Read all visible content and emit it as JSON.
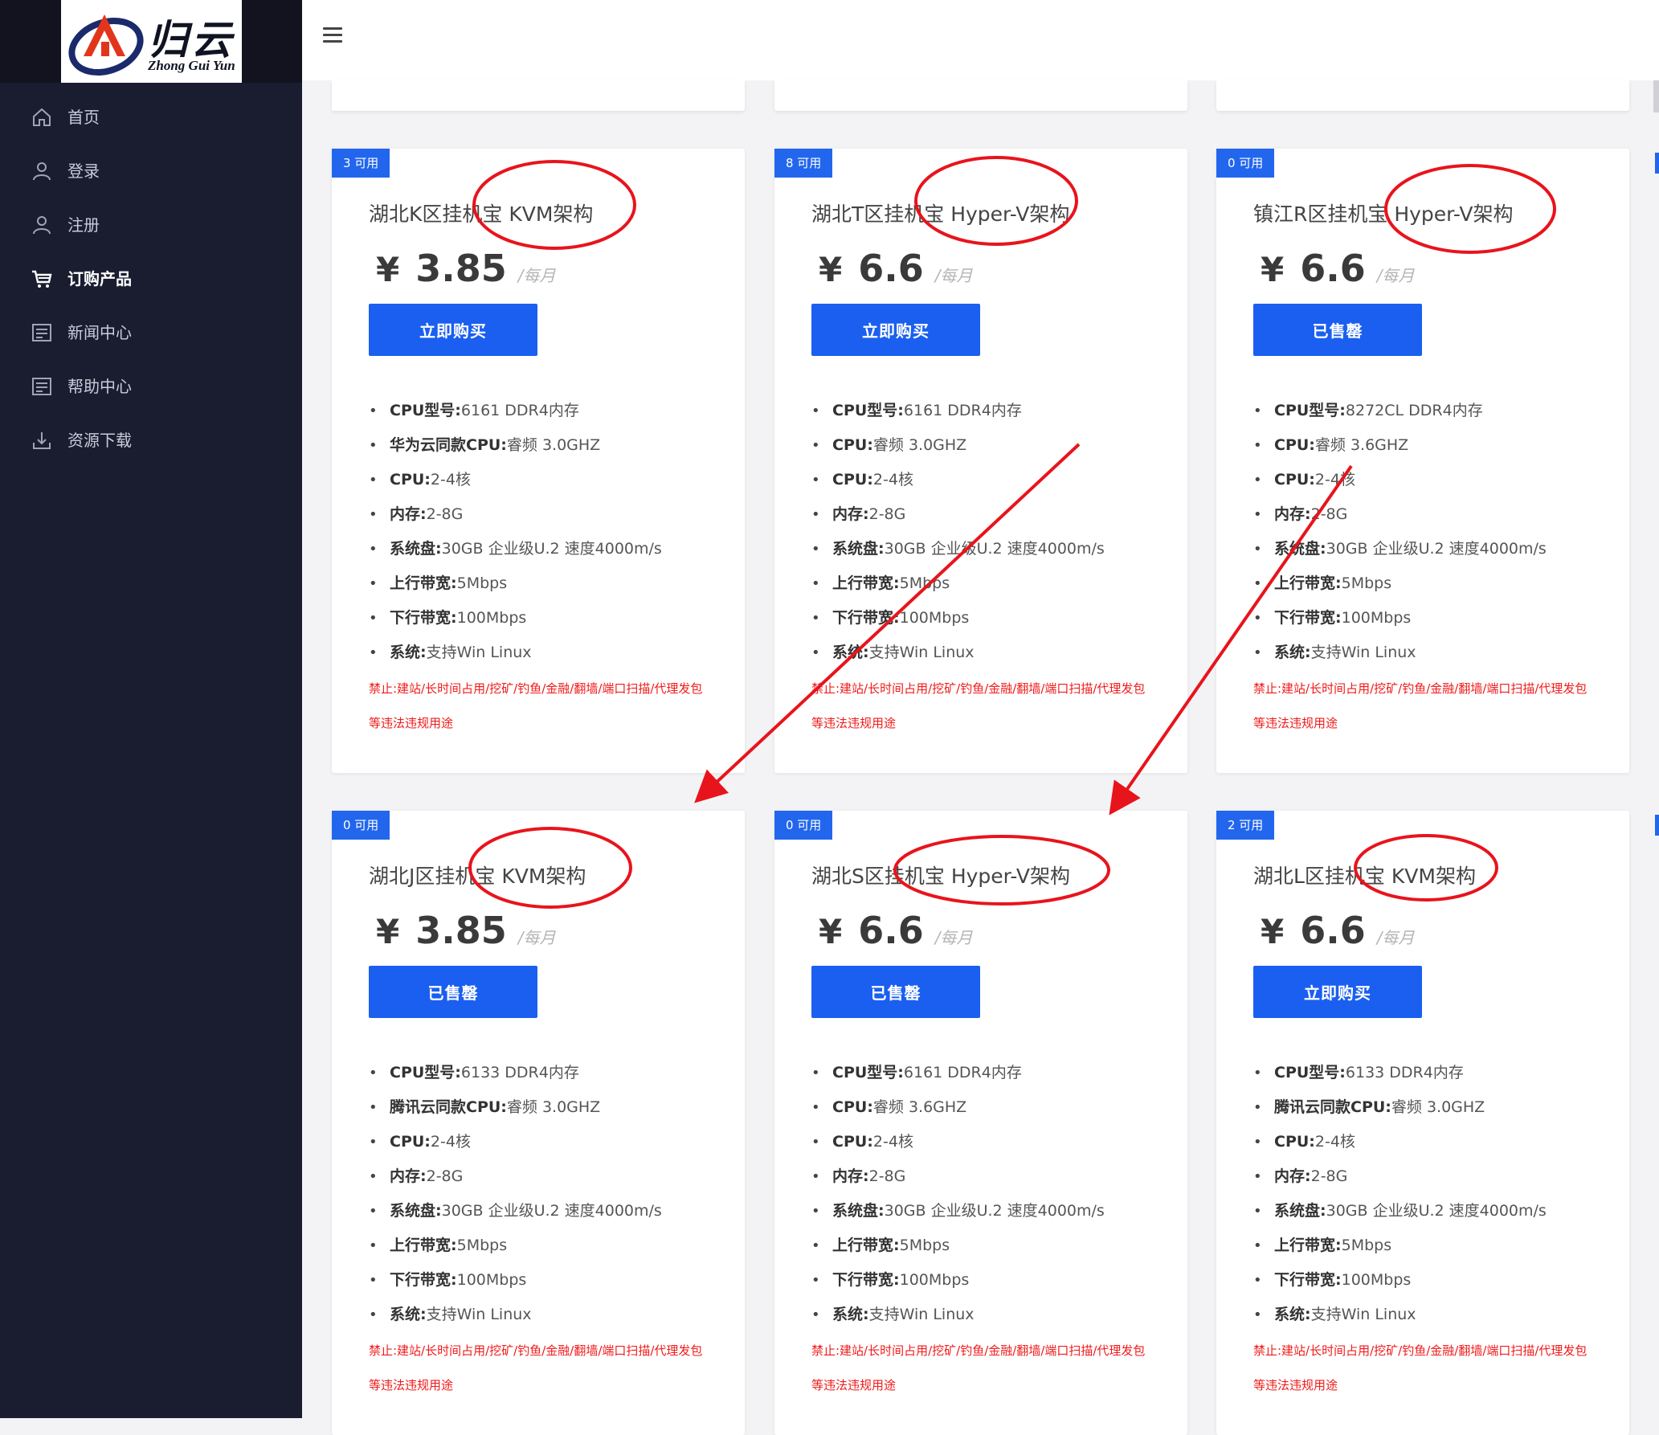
{
  "logo": {
    "text": "归云",
    "sub": "Zhong Gui Yun"
  },
  "nav": [
    {
      "label": "首页",
      "icon": "home-icon",
      "active": false
    },
    {
      "label": "登录",
      "icon": "user-icon",
      "active": false
    },
    {
      "label": "注册",
      "icon": "user-icon",
      "active": false
    },
    {
      "label": "订购产品",
      "icon": "cart-icon",
      "active": true
    },
    {
      "label": "新闻中心",
      "icon": "document-icon",
      "active": false
    },
    {
      "label": "帮助中心",
      "icon": "document-icon",
      "active": false
    },
    {
      "label": "资源下载",
      "icon": "download-icon",
      "active": false
    }
  ],
  "accent": "#1a5ff0",
  "annotation_color": "#e8141c",
  "warn_color": "#f01a1a",
  "products": [
    {
      "badge": "3 可用",
      "title": "湖北K区挂机宝 KVM架构",
      "currency": "¥",
      "price": "3.85",
      "period": "/每月",
      "button": "立即购买",
      "specs": [
        {
          "k": "CPU型号:",
          "v": "6161 DDR4内存"
        },
        {
          "k": "华为云同款CPU:",
          "v": "睿频 3.0GHZ"
        },
        {
          "k": "CPU:",
          "v": "2-4核"
        },
        {
          "k": "内存:",
          "v": "2-8G"
        },
        {
          "k": "系统盘:",
          "v": "30GB 企业级U.2 速度4000m/s"
        },
        {
          "k": "上行带宽:",
          "v": "5Mbps"
        },
        {
          "k": "下行带宽:",
          "v": "100Mbps"
        },
        {
          "k": "系统:",
          "v": "支持Win Linux"
        }
      ],
      "warn": "禁止:建站/长时间占用/挖矿/钓鱼/金融/翻墙/端口扫描/代理发包等违法违规用途"
    },
    {
      "badge": "8 可用",
      "title": "湖北T区挂机宝 Hyper-V架构",
      "currency": "¥",
      "price": "6.6",
      "period": "/每月",
      "button": "立即购买",
      "specs": [
        {
          "k": "CPU型号:",
          "v": "6161 DDR4内存"
        },
        {
          "k": "CPU:",
          "v": "睿频 3.0GHZ"
        },
        {
          "k": "CPU:",
          "v": "2-4核"
        },
        {
          "k": "内存:",
          "v": "2-8G"
        },
        {
          "k": "系统盘:",
          "v": "30GB 企业级U.2 速度4000m/s"
        },
        {
          "k": "上行带宽:",
          "v": "5Mbps"
        },
        {
          "k": "下行带宽:",
          "v": "100Mbps"
        },
        {
          "k": "系统:",
          "v": "支持Win Linux"
        }
      ],
      "warn": "禁止:建站/长时间占用/挖矿/钓鱼/金融/翻墙/端口扫描/代理发包等违法违规用途"
    },
    {
      "badge": "0 可用",
      "title": "镇江R区挂机宝 Hyper-V架构",
      "currency": "¥",
      "price": "6.6",
      "period": "/每月",
      "button": "已售罄",
      "specs": [
        {
          "k": "CPU型号:",
          "v": "8272CL DDR4内存"
        },
        {
          "k": "CPU:",
          "v": "睿频 3.6GHZ"
        },
        {
          "k": "CPU:",
          "v": "2-4核"
        },
        {
          "k": "内存:",
          "v": "2-8G"
        },
        {
          "k": "系统盘:",
          "v": "30GB 企业级U.2 速度4000m/s"
        },
        {
          "k": "上行带宽:",
          "v": "5Mbps"
        },
        {
          "k": "下行带宽:",
          "v": "100Mbps"
        },
        {
          "k": "系统:",
          "v": "支持Win Linux"
        }
      ],
      "warn": "禁止:建站/长时间占用/挖矿/钓鱼/金融/翻墙/端口扫描/代理发包等违法违规用途"
    },
    {
      "badge": "0 可用",
      "title": "湖北J区挂机宝 KVM架构",
      "currency": "¥",
      "price": "3.85",
      "period": "/每月",
      "button": "已售罄",
      "specs": [
        {
          "k": "CPU型号:",
          "v": "6133 DDR4内存"
        },
        {
          "k": "腾讯云同款CPU:",
          "v": "睿频 3.0GHZ"
        },
        {
          "k": "CPU:",
          "v": "2-4核"
        },
        {
          "k": "内存:",
          "v": "2-8G"
        },
        {
          "k": "系统盘:",
          "v": "30GB 企业级U.2 速度4000m/s"
        },
        {
          "k": "上行带宽:",
          "v": "5Mbps"
        },
        {
          "k": "下行带宽:",
          "v": "100Mbps"
        },
        {
          "k": "系统:",
          "v": "支持Win Linux"
        }
      ],
      "warn": "禁止:建站/长时间占用/挖矿/钓鱼/金融/翻墙/端口扫描/代理发包等违法违规用途"
    },
    {
      "badge": "0 可用",
      "title": "湖北S区挂机宝 Hyper-V架构",
      "currency": "¥",
      "price": "6.6",
      "period": "/每月",
      "button": "已售罄",
      "specs": [
        {
          "k": "CPU型号:",
          "v": "6161 DDR4内存"
        },
        {
          "k": "CPU:",
          "v": "睿频 3.6GHZ"
        },
        {
          "k": "CPU:",
          "v": "2-4核"
        },
        {
          "k": "内存:",
          "v": "2-8G"
        },
        {
          "k": "系统盘:",
          "v": "30GB 企业级U.2 速度4000m/s"
        },
        {
          "k": "上行带宽:",
          "v": "5Mbps"
        },
        {
          "k": "下行带宽:",
          "v": "100Mbps"
        },
        {
          "k": "系统:",
          "v": "支持Win Linux"
        }
      ],
      "warn": "禁止:建站/长时间占用/挖矿/钓鱼/金融/翻墙/端口扫描/代理发包等违法违规用途"
    },
    {
      "badge": "2 可用",
      "title": "湖北L区挂机宝 KVM架构",
      "currency": "¥",
      "price": "6.6",
      "period": "/每月",
      "button": "立即购买",
      "specs": [
        {
          "k": "CPU型号:",
          "v": "6133 DDR4内存"
        },
        {
          "k": "腾讯云同款CPU:",
          "v": "睿频 3.0GHZ"
        },
        {
          "k": "CPU:",
          "v": "2-4核"
        },
        {
          "k": "内存:",
          "v": "2-8G"
        },
        {
          "k": "系统盘:",
          "v": "30GB 企业级U.2 速度4000m/s"
        },
        {
          "k": "上行带宽:",
          "v": "5Mbps"
        },
        {
          "k": "下行带宽:",
          "v": "100Mbps"
        },
        {
          "k": "系统:",
          "v": "支持Win Linux"
        }
      ],
      "warn": "禁止:建站/长时间占用/挖矿/钓鱼/金融/翻墙/端口扫描/代理发包等违法违规用途"
    }
  ]
}
